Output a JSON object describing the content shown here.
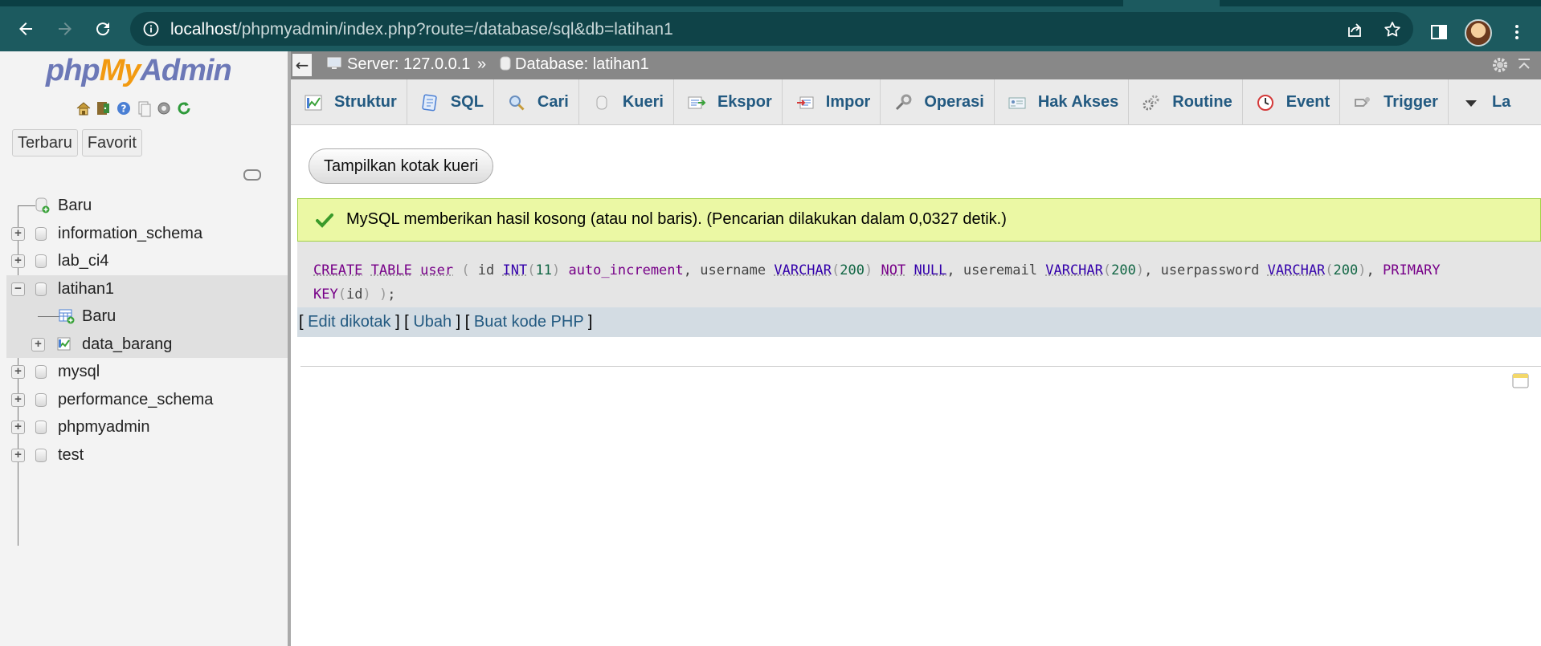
{
  "browser": {
    "url_host": "localhost",
    "url_path": "/phpmyadmin/index.php?route=/database/sql&db=latihan1",
    "icons": [
      "back-icon",
      "forward-icon",
      "reload-icon",
      "info-icon",
      "share-icon",
      "star-icon",
      "sidepanel-icon",
      "avatar",
      "menu-icon"
    ]
  },
  "logo": {
    "php": "php",
    "my": "My",
    "admin": "Admin"
  },
  "leftnav": {
    "tabs": [
      "Terbaru",
      "Favorit"
    ],
    "tree": [
      {
        "label": "Baru",
        "kind": "new"
      },
      {
        "label": "information_schema",
        "kind": "db"
      },
      {
        "label": "lab_ci4",
        "kind": "db"
      },
      {
        "label": "latihan1",
        "kind": "db",
        "expanded": true,
        "selected": true
      },
      {
        "label": "Baru",
        "kind": "new-table"
      },
      {
        "label": "data_barang",
        "kind": "table"
      },
      {
        "label": "mysql",
        "kind": "db"
      },
      {
        "label": "performance_schema",
        "kind": "db"
      },
      {
        "label": "phpmyadmin",
        "kind": "db"
      },
      {
        "label": "test",
        "kind": "db"
      }
    ]
  },
  "serverbar": {
    "server": "Server: 127.0.0.1",
    "separator": "»",
    "database": "Database: latihan1"
  },
  "tabs": [
    {
      "label": "Struktur",
      "icon": "structure-icon"
    },
    {
      "label": "SQL",
      "icon": "sql-icon"
    },
    {
      "label": "Cari",
      "icon": "search-icon"
    },
    {
      "label": "Kueri",
      "icon": "query-icon"
    },
    {
      "label": "Ekspor",
      "icon": "export-icon"
    },
    {
      "label": "Impor",
      "icon": "import-icon"
    },
    {
      "label": "Operasi",
      "icon": "operations-icon"
    },
    {
      "label": "Hak Akses",
      "icon": "privileges-icon"
    },
    {
      "label": "Routine",
      "icon": "routines-icon"
    },
    {
      "label": "Event",
      "icon": "events-icon"
    },
    {
      "label": "Trigger",
      "icon": "triggers-icon"
    },
    {
      "label": "La",
      "icon": "more-icon"
    }
  ],
  "main": {
    "show_query_button": "Tampilkan kotak kueri",
    "success_message": "MySQL memberikan hasil kosong (atau nol baris). (Pencarian dilakukan dalam 0,0327 detik.)",
    "actions": {
      "edit_inline": "Edit dikotak",
      "edit": "Ubah",
      "create_php": "Buat kode PHP"
    }
  },
  "colors": {
    "chrome": "#1c5a5f",
    "success_bg": "#ebf8a4",
    "link": "#235a81",
    "keyword": "#770088"
  }
}
